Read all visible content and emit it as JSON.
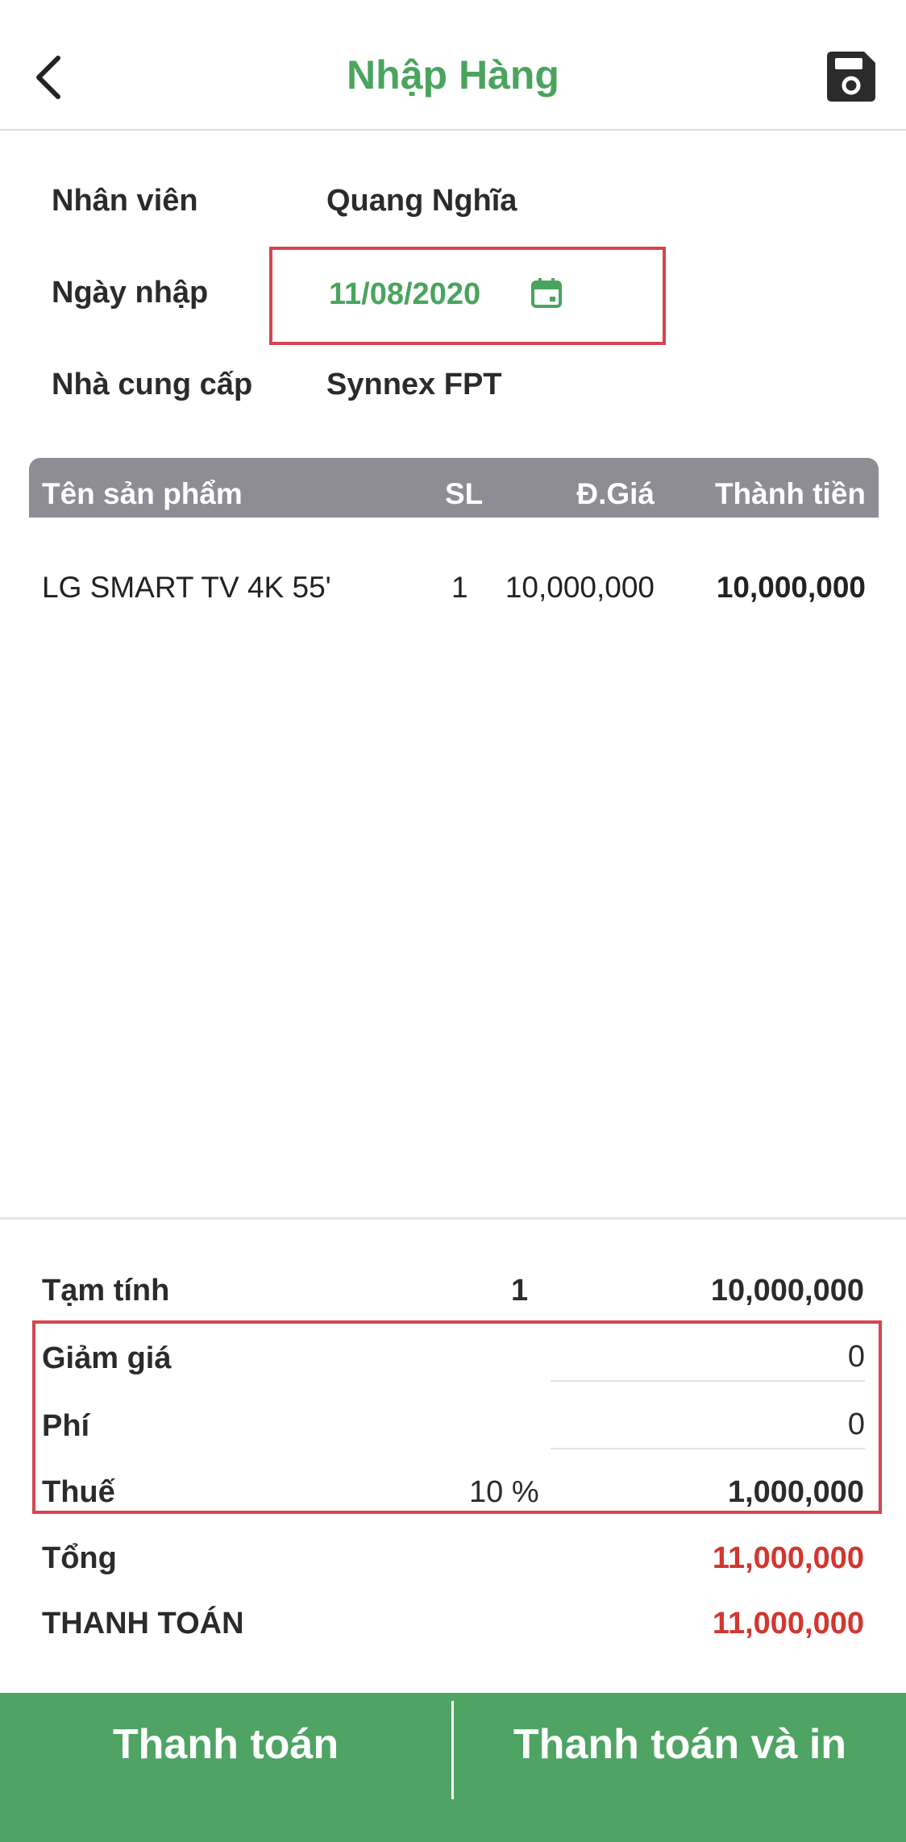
{
  "header": {
    "title": "Nhập Hàng",
    "back_icon": "chevron-left-icon",
    "save_icon": "floppy-disk-icon"
  },
  "info": {
    "employee_label": "Nhân viên",
    "employee_value": "Quang Nghĩa",
    "date_label": "Ngày nhập",
    "date_value": "11/08/2020",
    "supplier_label": "Nhà cung cấp",
    "supplier_value": "Synnex FPT"
  },
  "table": {
    "columns": [
      "Tên sản phẩm",
      "SL",
      "Đ.Giá",
      "Thành tiền"
    ],
    "rows": [
      {
        "name": "LG SMART TV 4K 55'",
        "qty": "1",
        "price": "10,000,000",
        "total": "10,000,000"
      }
    ]
  },
  "summary": {
    "subtotal_label": "Tạm tính",
    "subtotal_qty": "1",
    "subtotal_value": "10,000,000",
    "discount_label": "Giảm giá",
    "discount_value": "0",
    "fee_label": "Phí",
    "fee_value": "0",
    "tax_label": "Thuế",
    "tax_rate": "10 %",
    "tax_value": "1,000,000",
    "total_label": "Tổng",
    "total_value": "11,000,000",
    "payment_label": "THANH TOÁN",
    "payment_value": "11,000,000"
  },
  "footer": {
    "pay_label": "Thanh toán",
    "pay_print_label": "Thanh toán và in"
  },
  "colors": {
    "accent_green": "#4aa45e",
    "footer_green": "#4fa463",
    "highlight_red": "#d44550",
    "amount_red": "#d2362f",
    "table_header_gray": "#8e8d93"
  }
}
